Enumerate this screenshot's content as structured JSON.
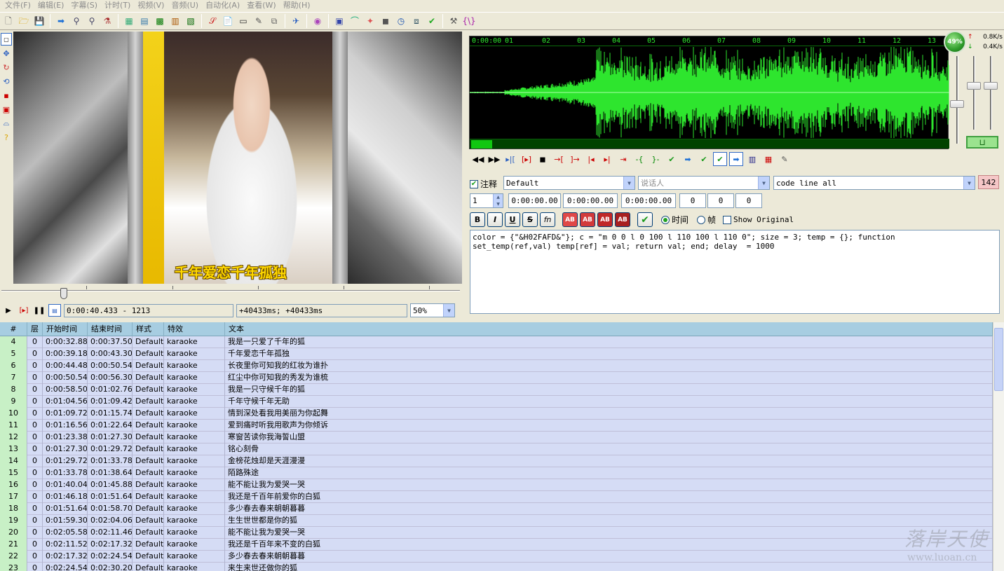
{
  "menu": [
    "文件(F)",
    "编辑(E)",
    "字幕(S)",
    "计时(T)",
    "视频(V)",
    "音频(U)",
    "自动化(A)",
    "查看(W)",
    "帮助(H)"
  ],
  "video": {
    "subtitle_overlay": "千年爱恋千年孤独",
    "time_display": "0:00:40.433 - 1213",
    "offset_display": "+40433ms; +40433ms",
    "zoom": "50%",
    "seek_position_fraction": 0.13
  },
  "audio": {
    "ruler": [
      "0:00:00",
      "01",
      "02",
      "03",
      "04",
      "05",
      "06",
      "07",
      "08",
      "09",
      "10",
      "11",
      "12",
      "13"
    ],
    "meter": "49%",
    "net_up": "0.8K/s",
    "net_down": "0.4K/s",
    "wave_color": "#2ee52e",
    "mode_label": "⊔"
  },
  "editor": {
    "comment_label": "注释",
    "style": "Default",
    "actor_placeholder": "说话人",
    "effect": "code line all",
    "char_count": "142",
    "layer": "1",
    "start_time": "0:00:00.00",
    "end_time": "0:00:00.00",
    "duration": "0:00:00.00",
    "margin_l": "0",
    "margin_r": "0",
    "margin_v": "0",
    "fmt_bold": "B",
    "fmt_italic": "I",
    "fmt_underline": "U",
    "fmt_strike": "S",
    "fmt_fn": "fn",
    "fmt_color1": "AB",
    "fmt_color2": "AB",
    "fmt_color3": "AB",
    "fmt_color4": "AB",
    "time_radio_label": "时间",
    "frame_radio_label": "帧",
    "show_original_label": "Show Original",
    "text": "color = {\"&H02FAFD&\"}; c = \"m 0 0 l 0 100 l 110 100 l 110 0\"; size = 3; temp = {}; function\nset_temp(ref,val) temp[ref] = val; return val; end; delay  = 1000"
  },
  "grid": {
    "headers": [
      "#",
      "层",
      "开始时间",
      "结束时间",
      "样式",
      "特效",
      "文本"
    ],
    "rows": [
      {
        "num": "4",
        "layer": "0",
        "start": "0:00:32.88",
        "end": "0:00:37.50",
        "style": "Default",
        "effect": "karaoke",
        "text": "我是一只爱了千年的狐"
      },
      {
        "num": "5",
        "layer": "0",
        "start": "0:00:39.18",
        "end": "0:00:43.30",
        "style": "Default",
        "effect": "karaoke",
        "text": "千年爱恋千年孤独"
      },
      {
        "num": "6",
        "layer": "0",
        "start": "0:00:44.48",
        "end": "0:00:50.54",
        "style": "Default",
        "effect": "karaoke",
        "text": "长夜里你可知我的红妆为谁扑"
      },
      {
        "num": "7",
        "layer": "0",
        "start": "0:00:50.54",
        "end": "0:00:56.30",
        "style": "Default",
        "effect": "karaoke",
        "text": "红尘中你可知我的秀发为谁梳"
      },
      {
        "num": "8",
        "layer": "0",
        "start": "0:00:58.50",
        "end": "0:01:02.76",
        "style": "Default",
        "effect": "karaoke",
        "text": "我是一只守候千年的狐"
      },
      {
        "num": "9",
        "layer": "0",
        "start": "0:01:04.56",
        "end": "0:01:09.42",
        "style": "Default",
        "effect": "karaoke",
        "text": "千年守候千年无助"
      },
      {
        "num": "10",
        "layer": "0",
        "start": "0:01:09.72",
        "end": "0:01:15.74",
        "style": "Default",
        "effect": "karaoke",
        "text": "情到深处看我用美丽为你起舞"
      },
      {
        "num": "11",
        "layer": "0",
        "start": "0:01:16.56",
        "end": "0:01:22.64",
        "style": "Default",
        "effect": "karaoke",
        "text": "爱到痛时听我用歌声为你倾诉"
      },
      {
        "num": "12",
        "layer": "0",
        "start": "0:01:23.38",
        "end": "0:01:27.30",
        "style": "Default",
        "effect": "karaoke",
        "text": "寒窗苦读你我海誓山盟"
      },
      {
        "num": "13",
        "layer": "0",
        "start": "0:01:27.30",
        "end": "0:01:29.72",
        "style": "Default",
        "effect": "karaoke",
        "text": "铭心刻骨"
      },
      {
        "num": "14",
        "layer": "0",
        "start": "0:01:29.72",
        "end": "0:01:33.78",
        "style": "Default",
        "effect": "karaoke",
        "text": "金榜花烛却是天涯漫漫"
      },
      {
        "num": "15",
        "layer": "0",
        "start": "0:01:33.78",
        "end": "0:01:38.64",
        "style": "Default",
        "effect": "karaoke",
        "text": "陌路殊途"
      },
      {
        "num": "16",
        "layer": "0",
        "start": "0:01:40.04",
        "end": "0:01:45.88",
        "style": "Default",
        "effect": "karaoke",
        "text": "能不能让我为爱哭一哭"
      },
      {
        "num": "17",
        "layer": "0",
        "start": "0:01:46.18",
        "end": "0:01:51.64",
        "style": "Default",
        "effect": "karaoke",
        "text": "我还是千百年前爱你的白狐"
      },
      {
        "num": "18",
        "layer": "0",
        "start": "0:01:51.64",
        "end": "0:01:58.70",
        "style": "Default",
        "effect": "karaoke",
        "text": "多少春去春来朝朝暮暮"
      },
      {
        "num": "19",
        "layer": "0",
        "start": "0:01:59.30",
        "end": "0:02:04.06",
        "style": "Default",
        "effect": "karaoke",
        "text": "生生世世都是你的狐"
      },
      {
        "num": "20",
        "layer": "0",
        "start": "0:02:05.58",
        "end": "0:02:11.46",
        "style": "Default",
        "effect": "karaoke",
        "text": "能不能让我为爱哭一哭"
      },
      {
        "num": "21",
        "layer": "0",
        "start": "0:02:11.52",
        "end": "0:02:17.32",
        "style": "Default",
        "effect": "karaoke",
        "text": "我还是千百年来不变的白狐"
      },
      {
        "num": "22",
        "layer": "0",
        "start": "0:02:17.32",
        "end": "0:02:24.54",
        "style": "Default",
        "effect": "karaoke",
        "text": "多少春去春来朝朝暮暮"
      },
      {
        "num": "23",
        "layer": "0",
        "start": "0:02:24.54",
        "end": "0:02:30.20",
        "style": "Default",
        "effect": "karaoke",
        "text": "来生来世还做你的狐"
      }
    ]
  },
  "watermark": {
    "line1": "落岸天使",
    "line2": "www.luoan.cn"
  }
}
